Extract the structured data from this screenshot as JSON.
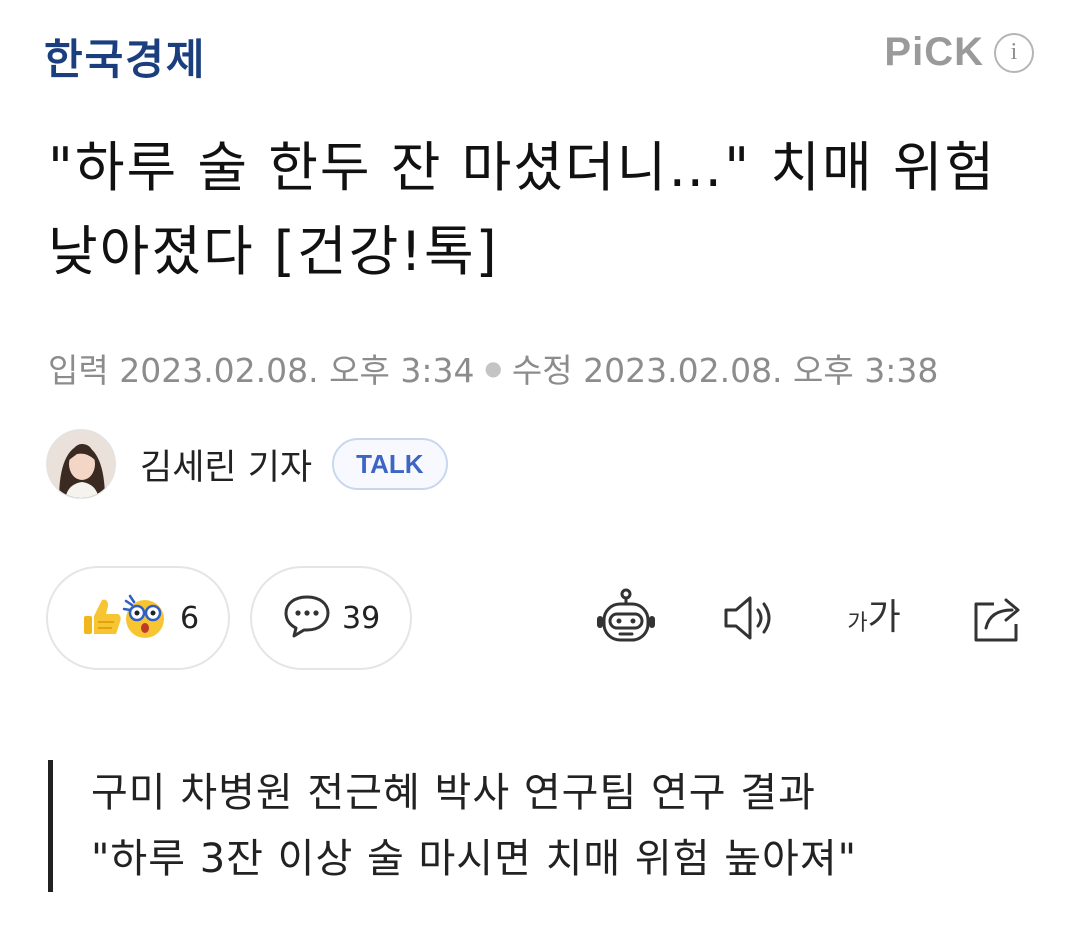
{
  "header": {
    "logo": "한국경제",
    "pick_label": "PiCK",
    "info_glyph": "i"
  },
  "article": {
    "title": "\"하루 술 한두 잔 마셨더니…\" 치매 위험 낮아졌다 [건강!톡]",
    "input_date": "입력 2023.02.08. 오후 3:34",
    "modified_date": "수정 2023.02.08. 오후 3:38",
    "reporter_name": "김세린 기자",
    "talk_label": "TALK"
  },
  "actions": {
    "reaction_count": "6",
    "comment_count": "39",
    "font_size_label": "가가",
    "icons": [
      "thumbs-up-emoji",
      "surprised-emoji",
      "comment-icon",
      "robot-icon",
      "speaker-icon",
      "font-size-icon",
      "share-icon"
    ]
  },
  "summary": {
    "lines": [
      "구미 차병원 전근혜 박사 연구팀 연구 결과",
      "\"하루 3잔 이상 술 마시면 치매 위험 높아져\""
    ]
  },
  "colors": {
    "logo": "#1a3e7e",
    "talk": "#3d66c4",
    "muted": "#8c8c8c"
  }
}
